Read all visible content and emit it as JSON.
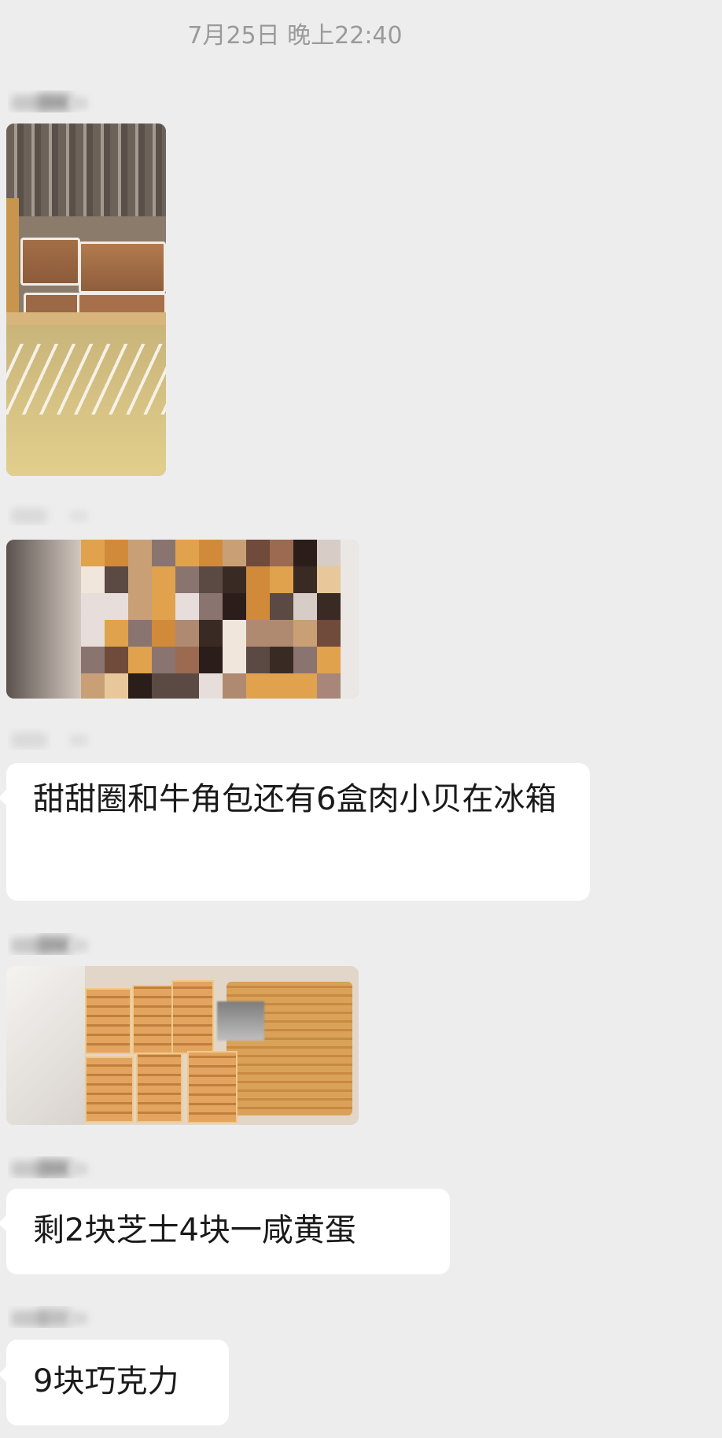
{
  "conversation": {
    "timestamp": "7月25日 晚上22:40"
  },
  "messages": [
    {
      "type": "image",
      "content": "photo-fridge-pastries"
    },
    {
      "type": "image",
      "content": "photo-pixelated"
    },
    {
      "type": "text",
      "text": "甜甜圈和牛角包还有6盒肉小贝在冰箱"
    },
    {
      "type": "image",
      "content": "photo-cakes"
    },
    {
      "type": "text",
      "text": "剩2块芝士4块一咸黄蛋"
    },
    {
      "type": "text",
      "text": "9块巧克力"
    }
  ],
  "colors": {
    "background": "#ededed",
    "bubble": "#ffffff",
    "timestamp_text": "#9a9a9a"
  }
}
